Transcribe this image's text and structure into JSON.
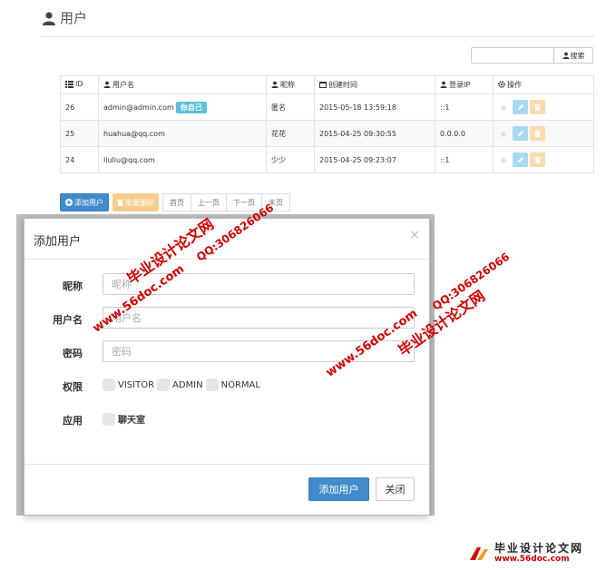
{
  "page": {
    "title": "用户"
  },
  "search": {
    "placeholder": "",
    "button_label": "搜索"
  },
  "table": {
    "headers": {
      "id": "ID",
      "username": "用户名",
      "nickname": "昵称",
      "created": "创建时间",
      "login_ip": "登录IP",
      "actions": "操作"
    },
    "rows": [
      {
        "id": "26",
        "username": "admin@admin.com",
        "badge": "你自己",
        "nickname": "匿名",
        "created": "2015-05-18 13:59:18",
        "login_ip": "::1"
      },
      {
        "id": "25",
        "username": "huahua@qq.com",
        "nickname": "花花",
        "created": "2015-04-25 09:30:55",
        "login_ip": "0.0.0.0"
      },
      {
        "id": "24",
        "username": "liuliu@qq.com",
        "nickname": "少少",
        "created": "2015-04-25 09:23:07",
        "login_ip": "::1"
      }
    ]
  },
  "toolbar": {
    "add_label": "添加用户",
    "batch_delete_label": "批量删除",
    "pagination": {
      "first": "首页",
      "prev": "上一页",
      "next": "下一页",
      "last": "末页"
    }
  },
  "modal": {
    "title": "添加用户",
    "close_symbol": "×",
    "fields": {
      "nickname": {
        "label": "昵称",
        "placeholder": "昵称",
        "value": ""
      },
      "username": {
        "label": "用户名",
        "placeholder": "用户名",
        "value": ""
      },
      "password": {
        "label": "密码",
        "placeholder": "密码",
        "value": ""
      }
    },
    "permissions": {
      "label": "权限",
      "options": [
        "VISITOR",
        "ADMIN",
        "NORMAL"
      ]
    },
    "apps": {
      "label": "应用",
      "options": [
        "聊天室"
      ]
    },
    "submit_label": "添加用户",
    "cancel_label": "关闭"
  },
  "watermarks": {
    "site_name": "毕业设计论文网",
    "url": "www.56doc.com",
    "qq": "QQ:306826066"
  },
  "logo": {
    "name": "毕业设计论文网",
    "url": "www.56doc.com"
  },
  "colors": {
    "primary": "#428bca",
    "info": "#5bc0de",
    "warning": "#f0ad4e",
    "watermark": "#d40000"
  }
}
